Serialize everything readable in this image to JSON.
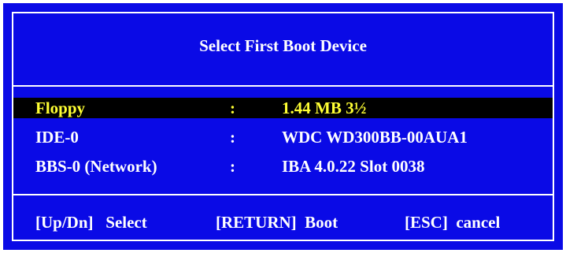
{
  "dialog": {
    "title": "Select First Boot Device",
    "devices": [
      {
        "name": "Floppy",
        "separator": ":",
        "description": "1.44 MB 3½",
        "selected": true
      },
      {
        "name": "IDE-0",
        "separator": ":",
        "description": "WDC WD300BB-00AUA1",
        "selected": false
      },
      {
        "name": "BBS-0 (Network)",
        "separator": ":",
        "description": "IBA 4.0.22 Slot 0038",
        "selected": false
      }
    ],
    "help": [
      {
        "key": "[Up/Dn]",
        "action": "Select"
      },
      {
        "key": "[RETURN]",
        "action": "Boot"
      },
      {
        "key": "[ESC]",
        "action": "cancel"
      }
    ]
  },
  "colors": {
    "background": "#0a0ae6",
    "text": "#ffffff",
    "selected_text": "#ffff33",
    "selected_background": "#000000"
  }
}
